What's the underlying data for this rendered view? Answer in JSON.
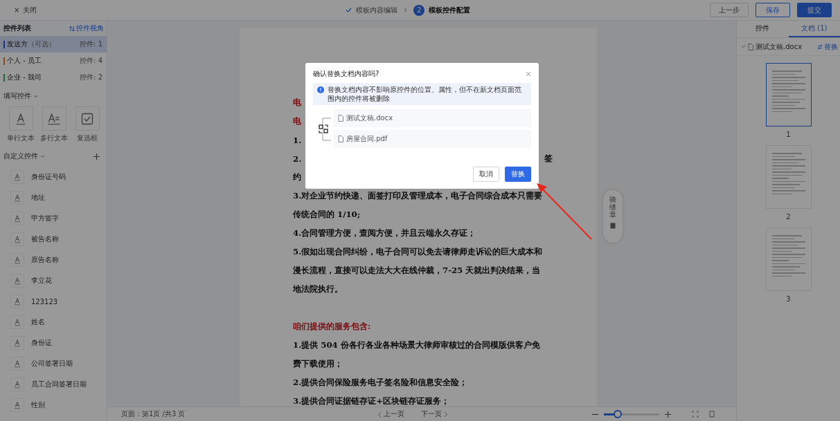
{
  "topbar": {
    "close": {
      "icon": "×",
      "label": "关闭"
    },
    "steps": [
      {
        "label": "模板内容编辑",
        "done": true,
        "selected": false
      },
      {
        "label": "模板控件配置",
        "done": false,
        "selected": true,
        "number": "2"
      }
    ],
    "buttons": [
      {
        "label": "上一步",
        "kind": "plain"
      },
      {
        "label": "保存",
        "kind": "outline"
      },
      {
        "label": "提交",
        "kind": "primary"
      }
    ]
  },
  "sidebar": {
    "title": "控件列表",
    "view_link": "控件视角",
    "signers": [
      {
        "name": "发送方",
        "note": "（可选）",
        "count": "控件: 1",
        "color": "#1c328d",
        "selected": true
      },
      {
        "name": "个人 - 员工",
        "count": "控件: 4",
        "color": "#904623",
        "selected": false
      },
      {
        "name": "企业 - 我司",
        "count": "控件: 2",
        "color": "#23633c",
        "selected": false
      }
    ],
    "fill_section": "填写控件",
    "fill_controls": [
      {
        "label": "单行文本",
        "kind": "single"
      },
      {
        "label": "多行文本",
        "kind": "multi"
      },
      {
        "label": "复选框",
        "kind": "checkbox"
      }
    ],
    "custom_section": "自定义控件",
    "custom_controls": [
      "身份证号码",
      "地址",
      "甲方签字",
      "被告名称",
      "原告名称",
      "李立花",
      "123123",
      "姓名",
      "身份证",
      "公司签署日期",
      "员工合同签署日期",
      "性别"
    ]
  },
  "document": {
    "lines": [
      {
        "text": "电",
        "kind": "heading"
      },
      {
        "text": "电",
        "kind": "heading"
      },
      {
        "text": "1.",
        "kind": "body"
      },
      {
        "text": "2.",
        "tail": "签",
        "kind": "body"
      },
      {
        "text": "约",
        "kind": "body"
      },
      {
        "text": "3.对企业节约快递、面签打印及管理成本，电子合同综合成本只需要",
        "kind": "body"
      },
      {
        "text": "传统合同的 1/10;",
        "kind": "body"
      },
      {
        "text": "4.合同管理方便，查阅方便，并且云端永久存证；",
        "kind": "body"
      },
      {
        "text": "5.假如出现合同纠纷，电子合同可以免去请律师走诉讼的巨大成本和",
        "kind": "body"
      },
      {
        "text": "漫长流程，直接可以走法大大在线仲裁，7-25 天就出判决结果，当",
        "kind": "body"
      },
      {
        "text": "地法院执行。",
        "kind": "body"
      },
      {
        "kind": "blank"
      },
      {
        "text": "咱们提供的服务包含:",
        "kind": "heading"
      },
      {
        "text": "1.提供 504 份各行各业各种场景大律师审核过的合同模版供客户免",
        "kind": "body"
      },
      {
        "text": "费下载使用；",
        "kind": "body"
      },
      {
        "text": "2.提供合同保险服务电子签名险和信息安全险；",
        "kind": "body"
      },
      {
        "text": "3.提供合同证据链存证+区块链存证服务；",
        "kind": "body"
      }
    ]
  },
  "float_tool": {
    "label": "骑缝章"
  },
  "bottom_bar": {
    "page_info": "页面：第1页 /共3 页",
    "prev": "上一页",
    "next": "下一页",
    "zoom": {
      "level": 0.25
    }
  },
  "right_panel": {
    "tabs": [
      {
        "label": "控件",
        "selected": false
      },
      {
        "label": "文档 (1)",
        "selected": true
      }
    ],
    "file": {
      "name": "测试文稿.docx",
      "action": "替换"
    },
    "pages": [
      {
        "number": "1",
        "selected": true
      },
      {
        "number": "2",
        "selected": false
      },
      {
        "number": "3",
        "selected": false
      }
    ]
  },
  "dialog": {
    "title": "确认替换文档内容吗?",
    "info": "替换文档内容不影响原控件的位置、属性，但不在新文档页面范围内的控件将被删除",
    "files": [
      "测试文稿.docx",
      "房屋合同.pdf"
    ],
    "cancel": "取消",
    "confirm": "替换"
  }
}
